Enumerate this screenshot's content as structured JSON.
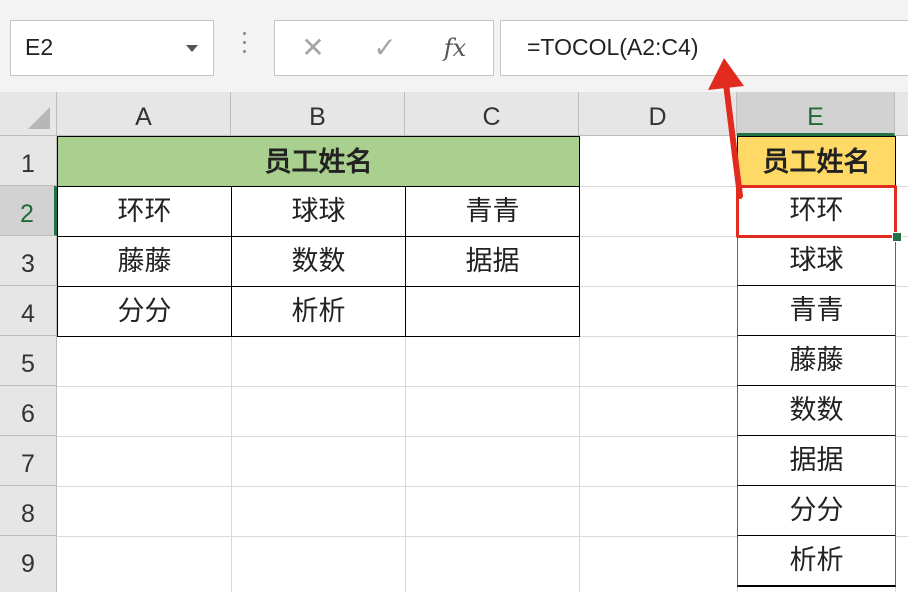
{
  "formula_bar": {
    "name_box": "E2",
    "cancel_icon": "✕",
    "enter_icon": "✓",
    "function_icon": "fx",
    "formula": "=TOCOL(A2:C4)"
  },
  "columns": [
    "A",
    "B",
    "C",
    "D",
    "E"
  ],
  "rows": [
    "1",
    "2",
    "3",
    "4",
    "5",
    "6",
    "7",
    "8",
    "9"
  ],
  "source_table": {
    "header": "员工姓名",
    "header_color": "#a9d08e",
    "cells": [
      [
        "环环",
        "球球",
        "青青"
      ],
      [
        "藤藤",
        "数数",
        "据据"
      ],
      [
        "分分",
        "析析",
        ""
      ]
    ]
  },
  "result_column": {
    "header": "员工姓名",
    "header_color": "#ffd966",
    "values": [
      "环环",
      "球球",
      "青青",
      "藤藤",
      "数数",
      "据据",
      "分分",
      "析析"
    ]
  },
  "active_cell": "E2",
  "highlight_color": "#e22b1f"
}
